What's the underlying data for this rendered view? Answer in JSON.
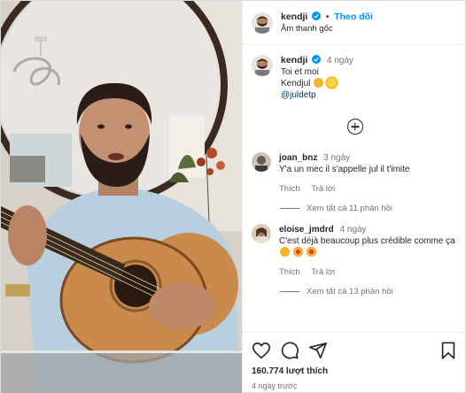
{
  "header": {
    "username": "kendji",
    "separator": "•",
    "follow_label": "Theo dõi",
    "audio_label": "Âm thanh gốc"
  },
  "caption": {
    "username": "kendji",
    "time": "4 ngày",
    "line1": "Toi et moi",
    "line2": "Kendjul",
    "mention": "@juldetp"
  },
  "comments": [
    {
      "username": "joan_bnz",
      "time": "3 ngày",
      "text": "Y'a un mec il s'appelle jul il t'imite",
      "reply_label": "Trả lời",
      "like_label": "Thích",
      "view_replies": "Xem tất cả 11 phản hồi"
    },
    {
      "username": "eloise_jmdrd",
      "time": "4 ngày",
      "text": "C'est déjà beaucoup plus crédible comme ça",
      "reply_label": "Trả lời",
      "like_label": "Thích",
      "view_replies": "Xem tất cả 13 phản hồi"
    }
  ],
  "actions": {
    "likes": "160.774 lượt thích",
    "posted_ago": "4 ngày trước"
  },
  "icons": [
    "verified-icon",
    "add-comment-icon",
    "heart-icon",
    "comment-icon",
    "share-icon",
    "bookmark-icon"
  ],
  "colors": {
    "link_blue": "#0095f6",
    "mention_blue": "#00376b",
    "secondary_text": "#737373"
  }
}
